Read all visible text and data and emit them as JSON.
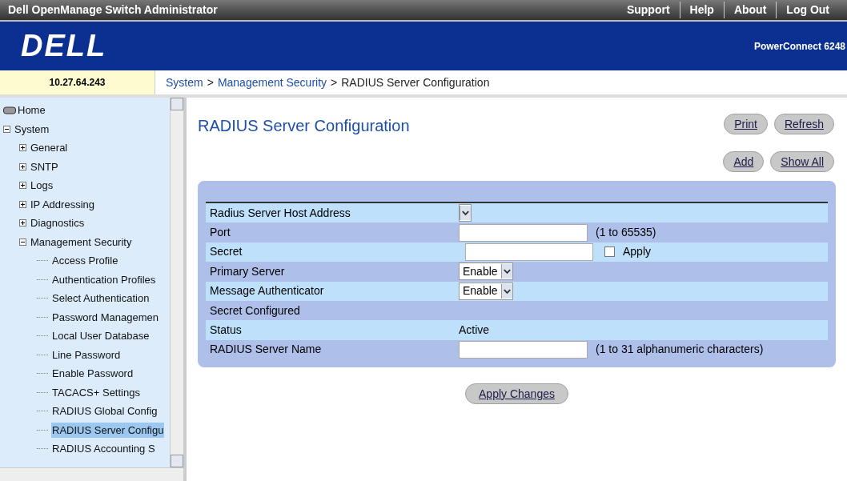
{
  "top_bar": {
    "title": "Dell OpenManage Switch Administrator",
    "links": [
      "Support",
      "Help",
      "About",
      "Log Out"
    ]
  },
  "banner": {
    "logo": "DELL",
    "model": "PowerConnect 6248"
  },
  "ip_address": "10.27.64.243",
  "breadcrumb": {
    "separator": ">",
    "items": [
      {
        "label": "System",
        "link": true
      },
      {
        "label": "Management Security",
        "link": true
      },
      {
        "label": "RADIUS Server Configuration",
        "link": false
      }
    ]
  },
  "sidebar": {
    "items": [
      {
        "label": "Home",
        "kind": "home",
        "selected": false
      },
      {
        "label": "System",
        "kind": "folder",
        "expanded": true,
        "selected": false,
        "children": [
          {
            "label": "General",
            "kind": "folder",
            "expanded": false,
            "selected": false
          },
          {
            "label": "SNTP",
            "kind": "folder",
            "expanded": false,
            "selected": false
          },
          {
            "label": "Logs",
            "kind": "folder",
            "expanded": false,
            "selected": false
          },
          {
            "label": "IP Addressing",
            "kind": "folder",
            "expanded": false,
            "selected": false
          },
          {
            "label": "Diagnostics",
            "kind": "folder",
            "expanded": false,
            "selected": false
          },
          {
            "label": "Management Security",
            "kind": "folder",
            "expanded": true,
            "selected": false,
            "children": [
              {
                "label": "Access Profile",
                "kind": "leaf",
                "selected": false
              },
              {
                "label": "Authentication Profiles",
                "kind": "leaf",
                "selected": false
              },
              {
                "label": "Select Authentication",
                "kind": "leaf",
                "selected": false
              },
              {
                "label": "Password Managemen",
                "kind": "leaf",
                "selected": false
              },
              {
                "label": "Local User Database",
                "kind": "leaf",
                "selected": false
              },
              {
                "label": "Line Password",
                "kind": "leaf",
                "selected": false
              },
              {
                "label": "Enable Password",
                "kind": "leaf",
                "selected": false
              },
              {
                "label": "TACACS+ Settings",
                "kind": "leaf",
                "selected": false
              },
              {
                "label": "RADIUS Global Config",
                "kind": "leaf",
                "selected": false
              },
              {
                "label": "RADIUS Server Configu",
                "kind": "leaf",
                "selected": true
              },
              {
                "label": "RADIUS Accounting S",
                "kind": "leaf",
                "selected": false
              }
            ]
          }
        ]
      }
    ]
  },
  "page": {
    "title": "RADIUS Server Configuration",
    "buttons_top": [
      "Print",
      "Refresh"
    ],
    "buttons_second": [
      "Add",
      "Show All"
    ],
    "rows": [
      {
        "kind": "select",
        "label": "Radius Server Host Address"
      },
      {
        "kind": "text",
        "label": "Port",
        "hint": "(1 to 65535)"
      },
      {
        "kind": "secret",
        "label": "Secret",
        "checkbox_label": "Apply",
        "checked": false
      },
      {
        "kind": "select",
        "label": "Primary Server",
        "value": "Enable"
      },
      {
        "kind": "select",
        "label": "Message Authenticator",
        "value": "Enable"
      },
      {
        "kind": "static",
        "label": "Secret Configured"
      },
      {
        "kind": "static",
        "label": "Status",
        "value": "Active"
      },
      {
        "kind": "text",
        "label": "RADIUS Server Name",
        "hint": "(1 to 31 alphanumeric characters)"
      }
    ],
    "apply_button": "Apply Changes"
  }
}
